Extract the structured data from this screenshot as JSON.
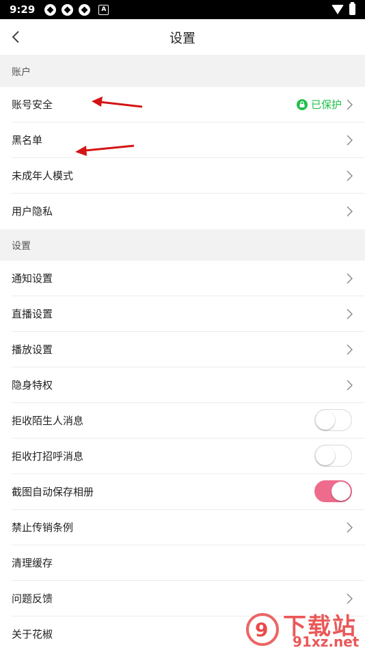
{
  "statusbar": {
    "time": "9:29",
    "icons": [
      "app-notification-icon",
      "app-notification-icon",
      "app-notification-icon",
      "a-notification-icon"
    ],
    "aicon": "A"
  },
  "header": {
    "title": "设置"
  },
  "sections": [
    {
      "title": "账户"
    },
    {
      "title": "设置"
    }
  ],
  "account_items": [
    {
      "label": "账号安全",
      "status": "已保护"
    },
    {
      "label": "黑名单"
    },
    {
      "label": "未成年人模式"
    },
    {
      "label": "用户隐私"
    }
  ],
  "settings_items": [
    {
      "label": "通知设置"
    },
    {
      "label": "直播设置"
    },
    {
      "label": "播放设置"
    },
    {
      "label": "隐身特权"
    },
    {
      "label": "拒收陌生人消息",
      "toggle": "off"
    },
    {
      "label": "拒收打招呼消息",
      "toggle": "off"
    },
    {
      "label": "截图自动保存相册",
      "toggle": "on"
    },
    {
      "label": "禁止传销条例"
    },
    {
      "label": "清理缓存"
    },
    {
      "label": "问题反馈"
    },
    {
      "label": "关于花椒"
    }
  ],
  "colors": {
    "accent_pink": "#ef6b8d",
    "protected_green": "#1fbf4a",
    "annotation_red": "#d41414"
  },
  "watermark": {
    "logo_text": "9",
    "title": "下载站",
    "domain": "91xz.net"
  }
}
